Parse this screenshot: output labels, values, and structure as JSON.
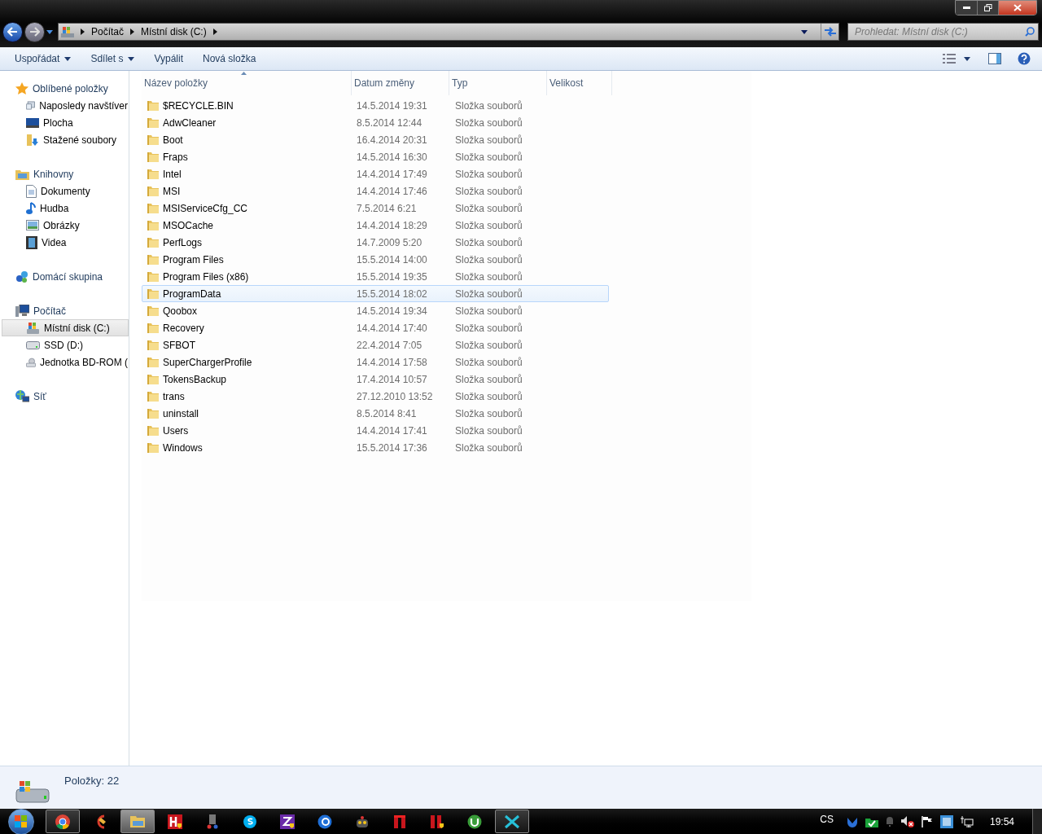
{
  "address_bar": {
    "crumbs": [
      "Počítač",
      "Místní disk (C:)"
    ]
  },
  "search": {
    "placeholder": "Prohledat: Místní disk (C:)"
  },
  "toolbar": {
    "buttons": [
      {
        "label": "Uspořádat",
        "dropdown": true
      },
      {
        "label": "Sdílet s",
        "dropdown": true
      },
      {
        "label": "Vypálit",
        "dropdown": false
      },
      {
        "label": "Nová složka",
        "dropdown": false
      }
    ]
  },
  "sidebar": {
    "groups": [
      {
        "label": "Oblíbené položky",
        "children": [
          {
            "label": "Naposledy navštíver",
            "selected": false
          },
          {
            "label": "Plocha",
            "selected": false
          },
          {
            "label": "Stažené soubory",
            "selected": false
          }
        ]
      },
      {
        "label": "Knihovny",
        "children": [
          {
            "label": "Dokumenty",
            "selected": false
          },
          {
            "label": "Hudba",
            "selected": false
          },
          {
            "label": "Obrázky",
            "selected": false
          },
          {
            "label": "Videa",
            "selected": false
          }
        ]
      },
      {
        "label": "Domácí skupina"
      },
      {
        "label": "Počítač",
        "children": [
          {
            "label": "Místní disk (C:)",
            "selected": true
          },
          {
            "label": "SSD (D:)",
            "selected": false
          },
          {
            "label": "Jednotka BD-ROM (",
            "selected": false
          }
        ]
      },
      {
        "label": "Síť"
      }
    ]
  },
  "table": {
    "columns": [
      "Název položky",
      "Datum změny",
      "Typ",
      "Velikost"
    ],
    "rows": [
      {
        "name": "$RECYCLE.BIN",
        "date": "14.5.2014 19:31",
        "type": "Složka souborů",
        "selected": false
      },
      {
        "name": "AdwCleaner",
        "date": "8.5.2014 12:44",
        "type": "Složka souborů",
        "selected": false
      },
      {
        "name": "Boot",
        "date": "16.4.2014 20:31",
        "type": "Složka souborů",
        "selected": false
      },
      {
        "name": "Fraps",
        "date": "14.5.2014 16:30",
        "type": "Složka souborů",
        "selected": false
      },
      {
        "name": "Intel",
        "date": "14.4.2014 17:49",
        "type": "Složka souborů",
        "selected": false
      },
      {
        "name": "MSI",
        "date": "14.4.2014 17:46",
        "type": "Složka souborů",
        "selected": false
      },
      {
        "name": "MSIServiceCfg_CC",
        "date": "7.5.2014 6:21",
        "type": "Složka souborů",
        "selected": false
      },
      {
        "name": "MSOCache",
        "date": "14.4.2014 18:29",
        "type": "Složka souborů",
        "selected": false
      },
      {
        "name": "PerfLogs",
        "date": "14.7.2009 5:20",
        "type": "Složka souborů",
        "selected": false
      },
      {
        "name": "Program Files",
        "date": "15.5.2014 14:00",
        "type": "Složka souborů",
        "selected": false
      },
      {
        "name": "Program Files (x86)",
        "date": "15.5.2014 19:35",
        "type": "Složka souborů",
        "selected": false
      },
      {
        "name": "ProgramData",
        "date": "15.5.2014 18:02",
        "type": "Složka souborů",
        "selected": true
      },
      {
        "name": "Qoobox",
        "date": "14.5.2014 19:34",
        "type": "Složka souborů",
        "selected": false
      },
      {
        "name": "Recovery",
        "date": "14.4.2014 17:40",
        "type": "Složka souborů",
        "selected": false
      },
      {
        "name": "SFBOT",
        "date": "22.4.2014 7:05",
        "type": "Složka souborů",
        "selected": false
      },
      {
        "name": "SuperChargerProfile",
        "date": "14.4.2014 17:58",
        "type": "Složka souborů",
        "selected": false
      },
      {
        "name": "TokensBackup",
        "date": "17.4.2014 10:57",
        "type": "Složka souborů",
        "selected": false
      },
      {
        "name": "trans",
        "date": "27.12.2010 13:52",
        "type": "Složka souborů",
        "selected": false
      },
      {
        "name": "uninstall",
        "date": "8.5.2014 8:41",
        "type": "Složka souborů",
        "selected": false
      },
      {
        "name": "Users",
        "date": "14.4.2014 17:41",
        "type": "Složka souborů",
        "selected": false
      },
      {
        "name": "Windows",
        "date": "15.5.2014 17:36",
        "type": "Složka souborů",
        "selected": false
      }
    ]
  },
  "status_bar": {
    "text": "Položky: 22"
  },
  "taskbar": {
    "items": [
      {
        "running": true,
        "selected": false
      },
      {
        "running": false,
        "selected": false
      },
      {
        "running": true,
        "selected": true
      },
      {
        "running": false,
        "selected": false
      },
      {
        "running": false,
        "selected": false
      },
      {
        "running": false,
        "selected": false
      },
      {
        "running": false,
        "selected": false
      },
      {
        "running": false,
        "selected": false
      },
      {
        "running": false,
        "selected": false
      },
      {
        "running": false,
        "selected": false
      },
      {
        "running": false,
        "selected": false
      },
      {
        "running": false,
        "selected": false
      },
      {
        "running": true,
        "selected": false
      }
    ],
    "language": "CS",
    "clock": "19:54"
  }
}
